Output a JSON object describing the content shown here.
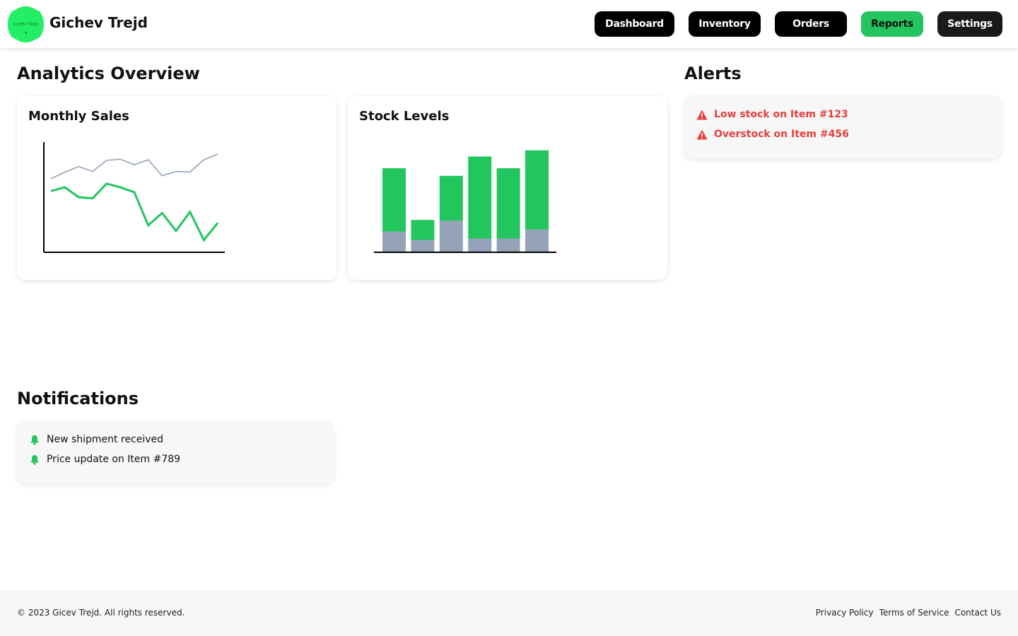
{
  "brand": {
    "logo_text": "GICHEV TREJD",
    "name": "Gichev Trejd",
    "logo_color": "#22ee66"
  },
  "nav": [
    {
      "label": "Dashboard"
    },
    {
      "label": "Inventory"
    },
    {
      "label": "Orders"
    },
    {
      "label": "Reports",
      "active": true
    },
    {
      "label": "Settings"
    }
  ],
  "analytics": {
    "title": "Analytics Overview",
    "monthly_sales": {
      "title": "Monthly Sales"
    },
    "stock_levels": {
      "title": "Stock Levels"
    }
  },
  "alerts": {
    "title": "Alerts",
    "items": [
      {
        "icon": "warning-icon",
        "text": "Low stock on Item #123"
      },
      {
        "icon": "warning-icon",
        "text": "Overstock on Item #456"
      }
    ]
  },
  "notifications": {
    "title": "Notifications",
    "items": [
      {
        "icon": "bell-icon",
        "text": "New shipment received"
      },
      {
        "icon": "bell-icon",
        "text": "Price update on Item #789"
      }
    ]
  },
  "footer": {
    "copyright": "© 2023 Gicev Trejd. All rights reserved.",
    "links": [
      "Privacy Policy",
      "Terms of Service",
      "Contact Us"
    ]
  },
  "colors": {
    "accent": "#22c55e",
    "secondary": "#94a3b8",
    "alert": "#e53e3e"
  },
  "chart_data": [
    {
      "type": "line",
      "title": "Monthly Sales",
      "x": [
        1,
        2,
        3,
        4,
        5,
        6,
        7,
        8,
        9,
        10,
        11,
        12,
        13
      ],
      "series": [
        {
          "values": [
            6.0,
            7.1,
            8.0,
            7.2,
            9.0,
            9.2,
            8.3,
            9.1,
            6.5,
            7.2,
            7.1,
            9.1,
            10.0
          ],
          "color": "#94a3b8"
        },
        {
          "values": [
            4.0,
            4.6,
            3.0,
            2.8,
            5.2,
            4.6,
            3.8,
            -1.6,
            0.4,
            -2.5,
            0.6,
            -4.0,
            -1.2
          ],
          "color": "#22c55e"
        }
      ],
      "ylim": [
        -6,
        12
      ]
    },
    {
      "type": "bar",
      "stacked": true,
      "title": "Stock Levels",
      "categories": [
        "1",
        "2",
        "3",
        "4",
        "5",
        "6"
      ],
      "series": [
        {
          "values": [
            30,
            18,
            46,
            20,
            20,
            33
          ],
          "color": "#94a3b8"
        },
        {
          "values": [
            92,
            29,
            65,
            119,
            102,
            115
          ],
          "color": "#22c55e"
        }
      ],
      "ylim": [
        0,
        160
      ]
    }
  ]
}
